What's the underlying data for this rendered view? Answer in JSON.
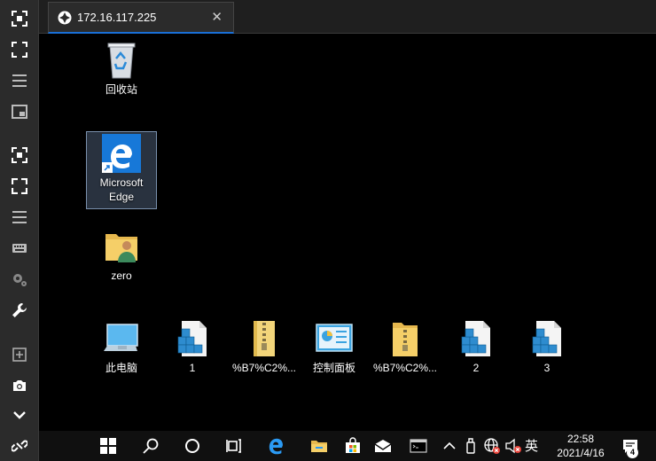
{
  "tab": {
    "title": "172.16.117.225",
    "close": "✕"
  },
  "desktop": {
    "recycle_bin": "回收站",
    "edge_line1": "Microsoft",
    "edge_line2": "Edge",
    "user_folder": "zero",
    "this_pc": "此电脑",
    "reg1": "1",
    "zip": "%B7%C2%...",
    "control_panel": "控制面板",
    "folder_zip": "%B7%C2%...",
    "reg2": "2",
    "reg3": "3"
  },
  "taskbar": {
    "ime": "英",
    "time": "22:58",
    "date": "2021/4/16",
    "notification_count": "4"
  },
  "colors": {
    "accent": "#1a6fd6",
    "toolbar": "#2b2b2b",
    "taskbar": "#101010"
  }
}
